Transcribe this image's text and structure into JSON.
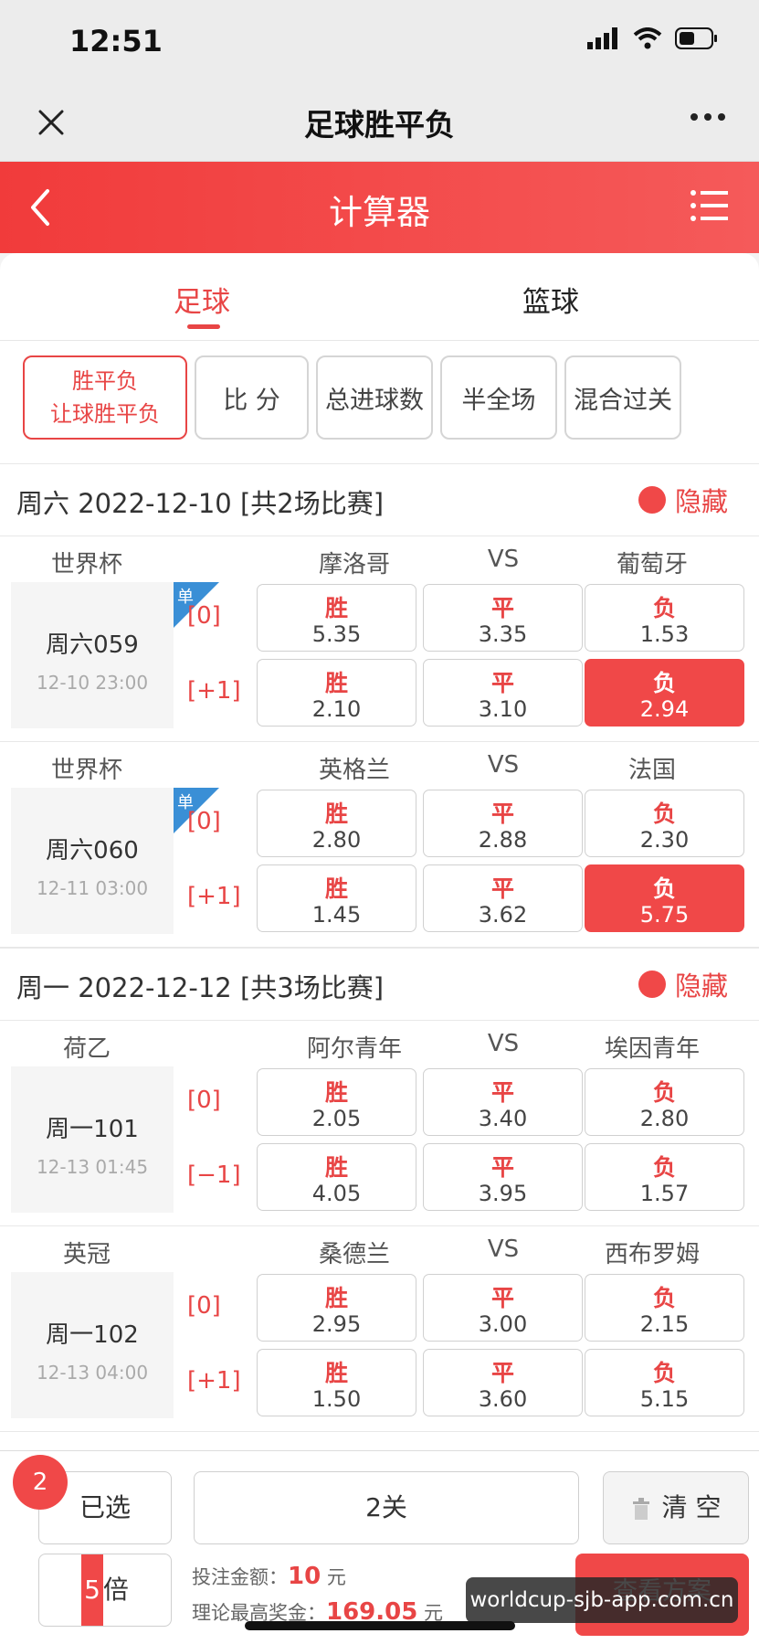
{
  "status": {
    "time": "12:51"
  },
  "nav": {
    "title": "足球胜平负"
  },
  "header": {
    "title": "计算器"
  },
  "sport_tabs": [
    "足球",
    "篮球"
  ],
  "play_tabs": {
    "active_line1": "胜平负",
    "active_line2": "让球胜平负",
    "others": [
      "比 分",
      "总进球数",
      "半全场",
      "混合过关"
    ]
  },
  "sections": [
    {
      "date": "周六 2022-12-10 [共2场比赛]",
      "hide": "隐藏"
    },
    {
      "date": "周一 2022-12-12 [共3场比赛]",
      "hide": "隐藏"
    }
  ],
  "vs": "VS",
  "dan_label": "单",
  "matches": [
    {
      "league": "世界杯",
      "home": "摩洛哥",
      "away": "葡萄牙",
      "code": "周六059",
      "time": "12-10 23:00",
      "dan": true,
      "rows": [
        {
          "handicap": "[0]",
          "odds": [
            {
              "label": "胜",
              "value": "5.35",
              "selected": false
            },
            {
              "label": "平",
              "value": "3.35",
              "selected": false
            },
            {
              "label": "负",
              "value": "1.53",
              "selected": false
            }
          ]
        },
        {
          "handicap": "[+1]",
          "odds": [
            {
              "label": "胜",
              "value": "2.10",
              "selected": false
            },
            {
              "label": "平",
              "value": "3.10",
              "selected": false
            },
            {
              "label": "负",
              "value": "2.94",
              "selected": true
            }
          ]
        }
      ]
    },
    {
      "league": "世界杯",
      "home": "英格兰",
      "away": "法国",
      "code": "周六060",
      "time": "12-11 03:00",
      "dan": true,
      "rows": [
        {
          "handicap": "[0]",
          "odds": [
            {
              "label": "胜",
              "value": "2.80",
              "selected": false
            },
            {
              "label": "平",
              "value": "2.88",
              "selected": false
            },
            {
              "label": "负",
              "value": "2.30",
              "selected": false
            }
          ]
        },
        {
          "handicap": "[+1]",
          "odds": [
            {
              "label": "胜",
              "value": "1.45",
              "selected": false
            },
            {
              "label": "平",
              "value": "3.62",
              "selected": false
            },
            {
              "label": "负",
              "value": "5.75",
              "selected": true
            }
          ]
        }
      ]
    },
    {
      "league": "荷乙",
      "home": "阿尔青年",
      "away": "埃因青年",
      "code": "周一101",
      "time": "12-13 01:45",
      "dan": false,
      "rows": [
        {
          "handicap": "[0]",
          "odds": [
            {
              "label": "胜",
              "value": "2.05",
              "selected": false
            },
            {
              "label": "平",
              "value": "3.40",
              "selected": false
            },
            {
              "label": "负",
              "value": "2.80",
              "selected": false
            }
          ]
        },
        {
          "handicap": "[−1]",
          "odds": [
            {
              "label": "胜",
              "value": "4.05",
              "selected": false
            },
            {
              "label": "平",
              "value": "3.95",
              "selected": false
            },
            {
              "label": "负",
              "value": "1.57",
              "selected": false
            }
          ]
        }
      ]
    },
    {
      "league": "英冠",
      "home": "桑德兰",
      "away": "西布罗姆",
      "code": "周一102",
      "time": "12-13 04:00",
      "dan": false,
      "rows": [
        {
          "handicap": "[0]",
          "odds": [
            {
              "label": "胜",
              "value": "2.95",
              "selected": false
            },
            {
              "label": "平",
              "value": "3.00",
              "selected": false
            },
            {
              "label": "负",
              "value": "2.15",
              "selected": false
            }
          ]
        },
        {
          "handicap": "[+1]",
          "odds": [
            {
              "label": "胜",
              "value": "1.50",
              "selected": false
            },
            {
              "label": "平",
              "value": "3.60",
              "selected": false
            },
            {
              "label": "负",
              "value": "5.15",
              "selected": false
            }
          ]
        }
      ]
    }
  ],
  "bottom": {
    "selected_count": "2",
    "selected_label": "已选",
    "pass_type": "2关",
    "clear_label": "清 空",
    "multiplier_num": "5",
    "multiplier_unit": "倍",
    "bet_amount_label": "投注金额：",
    "bet_amount": "10",
    "bet_amount_unit": "元",
    "max_prize_label": "理论最高奖金：",
    "max_prize": "169.05",
    "max_prize_unit": "元",
    "view_plan_label": "查看方案"
  },
  "watermark": "worldcup-sjb-app.com.cn"
}
